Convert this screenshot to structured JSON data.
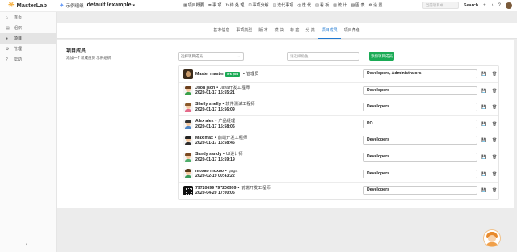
{
  "app": {
    "name": "MasterLab"
  },
  "project": {
    "org": "示例组织",
    "name": "default /example"
  },
  "topnav": [
    {
      "icon": "▦",
      "label": "项目概要",
      "name": "nav-summary"
    },
    {
      "icon": "≣",
      "label": "事 项",
      "name": "nav-issues"
    },
    {
      "icon": "↻",
      "label": "待 处 理",
      "name": "nav-backlog"
    },
    {
      "icon": "⊡",
      "label": "事项分解",
      "name": "nav-breakdown"
    },
    {
      "icon": "◫",
      "label": "迭代事项",
      "name": "nav-sprint-issues"
    },
    {
      "icon": "◷",
      "label": "迭 代",
      "name": "nav-sprints"
    },
    {
      "icon": "▤",
      "label": "看 板",
      "name": "nav-kanban"
    },
    {
      "icon": "▥",
      "label": "统 计",
      "name": "nav-stats"
    },
    {
      "icon": "▨",
      "label": "图 表",
      "name": "nav-charts"
    },
    {
      "icon": "⚙",
      "label": "设 置",
      "name": "nav-settings"
    }
  ],
  "search": {
    "placeholder": "当前项目中",
    "label": "Search"
  },
  "sidebar": [
    {
      "icon": "⌂",
      "label": "首页"
    },
    {
      "icon": "▤",
      "label": "组织"
    },
    {
      "icon": "●",
      "label": "项目"
    },
    {
      "icon": "⚙",
      "label": "管理"
    },
    {
      "icon": "?",
      "label": "帮助"
    }
  ],
  "sidebar_active_index": 2,
  "sidebar_collapse": "‹",
  "subnav": [
    "基本信息",
    "事项类型",
    "版 本",
    "模 块",
    "标 签",
    "分 类",
    "项目成员",
    "项目角色"
  ],
  "subnav_active_index": 6,
  "section": {
    "title": "项目成员",
    "desc": "添加一个新成员到 示例组织"
  },
  "controls": {
    "select_placeholder": "选择项目成员",
    "role_placeholder": "请选择角色",
    "add_button": "添加项目成员"
  },
  "members": [
    {
      "name": "Master master",
      "you": "It's you",
      "role": "管理员",
      "date": "",
      "field": "Developers, Administrators",
      "avatar": "photo"
    },
    {
      "name": "Json json",
      "role": "Java开发工程师",
      "date": "2020-01-17 15:55:21",
      "field": "Developers",
      "avatar": "cartoon",
      "hair": "#6b3f1d",
      "body": "#3aa04a"
    },
    {
      "name": "Shelly shelly",
      "role": "软件测试工程师",
      "date": "2020-01-17 15:56:09",
      "field": "Developers",
      "avatar": "cartoon",
      "hair": "#8a5a2b",
      "body": "#e56a8a"
    },
    {
      "name": "Alex alex",
      "role": "产品经理",
      "date": "2020-01-17 15:58:06",
      "field": "PO",
      "avatar": "cartoon",
      "hair": "#333333",
      "body": "#4f86c6"
    },
    {
      "name": "Max max",
      "role": "前端开发工程师",
      "date": "2020-01-17 15:58:46",
      "field": "Developers",
      "avatar": "cartoon",
      "hair": "#222222",
      "body": "#2d2d2d"
    },
    {
      "name": "Sandy sandy",
      "role": "UI设计师",
      "date": "2020-01-17 15:59:19",
      "field": "Developers",
      "avatar": "cartoon",
      "hair": "#7b4a22",
      "body": "#4fae6b"
    },
    {
      "name": "moxao moxao",
      "role": "gaga",
      "date": "2020-02-19 00:43:22",
      "field": "Developers",
      "avatar": "cartoon",
      "hair": "#5a3a1a",
      "body": "#3a9a5a"
    },
    {
      "name": "79720699 797206999",
      "role": "前端开发工程师",
      "date": "2020-04-20 17:00:06",
      "field": "Developers",
      "avatar": "dark"
    }
  ],
  "icons": {
    "save": "💾",
    "delete": "🗑"
  }
}
